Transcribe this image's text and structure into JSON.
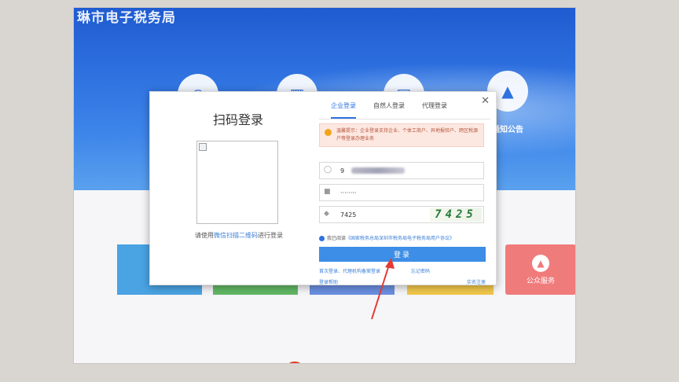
{
  "site": {
    "title": "琳市电子税务局",
    "notice_label": "通知公告"
  },
  "service_tiles": [
    {
      "color": "#4aa3e3"
    },
    {
      "color": "#62b865"
    },
    {
      "color": "#6b8fe0"
    },
    {
      "color": "#f1c84b"
    }
  ],
  "public_service": {
    "label": "公众服务"
  },
  "dialog": {
    "qr": {
      "title": "扫码登录",
      "hint_prefix": "请使用",
      "hint_link": "微信扫描二维码",
      "hint_suffix": "进行登录"
    },
    "tabs": [
      {
        "label": "企业登录",
        "active": true
      },
      {
        "label": "自然人登录",
        "active": false
      },
      {
        "label": "代理登录",
        "active": false
      }
    ],
    "tip": {
      "text": "温馨提示：企业登录支持企业、个体工商户、异地报验户、跨区税源户等登录办理业务"
    },
    "fields": {
      "account_value": "9",
      "password_value": "········",
      "captcha_input": "7425",
      "captcha_image": "7425"
    },
    "agreement": {
      "prefix": "我已阅读",
      "link": "《国家税务总局深圳市税务局电子税务局用户协议》"
    },
    "login_button": "登录",
    "links": {
      "register": "首次登录、代理机构备案登录",
      "forgot": "忘记密码",
      "help": "登录帮助",
      "signup": "实名注册"
    }
  },
  "colors": {
    "brand_blue": "#2f72e0",
    "login_button": "#3d8ee6",
    "tip_bg": "#fde8e1",
    "public_service": "#f07b7b"
  }
}
